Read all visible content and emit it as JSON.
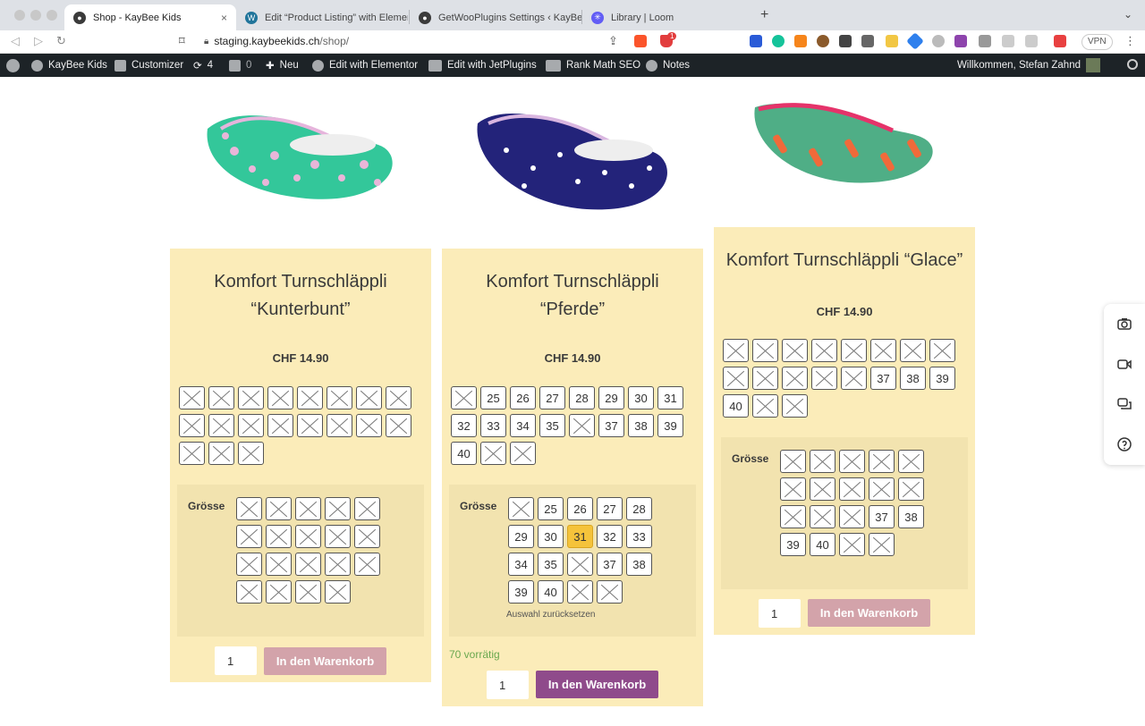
{
  "browser": {
    "tabs": [
      {
        "title": "Shop - KayBee Kids",
        "active": true
      },
      {
        "title": "Edit “Product Listing” with Elementor",
        "active": false
      },
      {
        "title": "GetWooPlugins Settings ‹ KayBee Kids",
        "active": false
      },
      {
        "title": "Library | Loom",
        "active": false
      }
    ],
    "new_tab_label": "+",
    "url_host": "staging.kaybeekids.ch",
    "url_path": "/shop/",
    "vpn_label": "VPN",
    "notification_count": "1"
  },
  "adminbar": {
    "site_name": "KayBee Kids",
    "customizer": "Customizer",
    "updates_count": "4",
    "comments_count": "0",
    "new_label": "Neu",
    "elementor": "Edit with Elementor",
    "jetplugins": "Edit with JetPlugins",
    "rankmath": "Rank Math SEO",
    "notes": "Notes",
    "greeting": "Willkommen, Stefan Zahnd"
  },
  "products": [
    {
      "name_line1": "Komfort Turnschläppli",
      "name_line2": "“Kunterbunt”",
      "price": "CHF 14.90",
      "shoe_colors": {
        "body": "#33c79a",
        "dots": "#e9b6d9",
        "trim": "#e6b4dc"
      },
      "swatches": [
        {
          "label": "",
          "out": true
        },
        {
          "label": "",
          "out": true
        },
        {
          "label": "",
          "out": true
        },
        {
          "label": "",
          "out": true
        },
        {
          "label": "",
          "out": true
        },
        {
          "label": "",
          "out": true
        },
        {
          "label": "",
          "out": true
        },
        {
          "label": "",
          "out": true
        },
        {
          "label": "",
          "out": true
        },
        {
          "label": "",
          "out": true
        },
        {
          "label": "",
          "out": true
        },
        {
          "label": "",
          "out": true
        },
        {
          "label": "",
          "out": true
        },
        {
          "label": "",
          "out": true
        },
        {
          "label": "",
          "out": true
        },
        {
          "label": "",
          "out": true
        },
        {
          "label": "",
          "out": true
        },
        {
          "label": "",
          "out": true
        },
        {
          "label": "",
          "out": true
        }
      ],
      "groesse_label": "Grösse",
      "options": [
        {
          "label": "",
          "out": true
        },
        {
          "label": "",
          "out": true
        },
        {
          "label": "",
          "out": true
        },
        {
          "label": "",
          "out": true
        },
        {
          "label": "",
          "out": true
        },
        {
          "label": "",
          "out": true
        },
        {
          "label": "",
          "out": true
        },
        {
          "label": "",
          "out": true
        },
        {
          "label": "",
          "out": true
        },
        {
          "label": "",
          "out": true
        },
        {
          "label": "",
          "out": true
        },
        {
          "label": "",
          "out": true
        },
        {
          "label": "",
          "out": true
        },
        {
          "label": "",
          "out": true
        },
        {
          "label": "",
          "out": true
        },
        {
          "label": "",
          "out": true
        },
        {
          "label": "",
          "out": true
        },
        {
          "label": "",
          "out": true
        },
        {
          "label": "",
          "out": true
        }
      ],
      "qty": "1",
      "cart_label": "In den Warenkorb",
      "cart_enabled": false
    },
    {
      "name_line1": "Komfort Turnschläppli",
      "name_line2": "“Pferde”",
      "price": "CHF 14.90",
      "shoe_colors": {
        "body": "#23237a",
        "dots": "#ffffff",
        "trim": "#d9b6e0"
      },
      "swatches": [
        {
          "label": "",
          "out": true
        },
        {
          "label": "25",
          "out": false
        },
        {
          "label": "26",
          "out": false
        },
        {
          "label": "27",
          "out": false
        },
        {
          "label": "28",
          "out": false
        },
        {
          "label": "29",
          "out": false
        },
        {
          "label": "30",
          "out": false
        },
        {
          "label": "31",
          "out": false
        },
        {
          "label": "32",
          "out": false
        },
        {
          "label": "33",
          "out": false
        },
        {
          "label": "34",
          "out": false
        },
        {
          "label": "35",
          "out": false
        },
        {
          "label": "",
          "out": true
        },
        {
          "label": "37",
          "out": false
        },
        {
          "label": "38",
          "out": false
        },
        {
          "label": "39",
          "out": false
        },
        {
          "label": "40",
          "out": false
        },
        {
          "label": "",
          "out": true
        },
        {
          "label": "",
          "out": true
        }
      ],
      "groesse_label": "Grösse",
      "options": [
        {
          "label": "",
          "out": true
        },
        {
          "label": "25",
          "out": false
        },
        {
          "label": "26",
          "out": false
        },
        {
          "label": "27",
          "out": false
        },
        {
          "label": "28",
          "out": false
        },
        {
          "label": "29",
          "out": false
        },
        {
          "label": "30",
          "out": false
        },
        {
          "label": "31",
          "out": false,
          "selected": true
        },
        {
          "label": "32",
          "out": false
        },
        {
          "label": "33",
          "out": false
        },
        {
          "label": "34",
          "out": false
        },
        {
          "label": "35",
          "out": false
        },
        {
          "label": "",
          "out": true
        },
        {
          "label": "37",
          "out": false
        },
        {
          "label": "38",
          "out": false
        },
        {
          "label": "39",
          "out": false
        },
        {
          "label": "40",
          "out": false
        },
        {
          "label": "",
          "out": true
        },
        {
          "label": "",
          "out": true
        }
      ],
      "reset_label": "Auswahl zurücksetzen",
      "stock_label": "70 vorrätig",
      "qty": "1",
      "cart_label": "In den Warenkorb",
      "cart_enabled": true
    },
    {
      "name_line1": "Komfort Turnschläppli “Glace”",
      "name_line2": "",
      "price": "CHF 14.90",
      "shoe_colors": {
        "body": "#4fae86",
        "dots": "#f06a3a",
        "trim": "#e5336a"
      },
      "swatches": [
        {
          "label": "",
          "out": true
        },
        {
          "label": "",
          "out": true
        },
        {
          "label": "",
          "out": true
        },
        {
          "label": "",
          "out": true
        },
        {
          "label": "",
          "out": true
        },
        {
          "label": "",
          "out": true
        },
        {
          "label": "",
          "out": true
        },
        {
          "label": "",
          "out": true
        },
        {
          "label": "",
          "out": true
        },
        {
          "label": "",
          "out": true
        },
        {
          "label": "",
          "out": true
        },
        {
          "label": "",
          "out": true
        },
        {
          "label": "",
          "out": true
        },
        {
          "label": "37",
          "out": false
        },
        {
          "label": "38",
          "out": false
        },
        {
          "label": "39",
          "out": false
        },
        {
          "label": "40",
          "out": false
        },
        {
          "label": "",
          "out": true
        },
        {
          "label": "",
          "out": true
        }
      ],
      "groesse_label": "Grösse",
      "options": [
        {
          "label": "",
          "out": true
        },
        {
          "label": "",
          "out": true
        },
        {
          "label": "",
          "out": true
        },
        {
          "label": "",
          "out": true
        },
        {
          "label": "",
          "out": true
        },
        {
          "label": "",
          "out": true
        },
        {
          "label": "",
          "out": true
        },
        {
          "label": "",
          "out": true
        },
        {
          "label": "",
          "out": true
        },
        {
          "label": "",
          "out": true
        },
        {
          "label": "",
          "out": true
        },
        {
          "label": "",
          "out": true
        },
        {
          "label": "",
          "out": true
        },
        {
          "label": "37",
          "out": false
        },
        {
          "label": "38",
          "out": false
        },
        {
          "label": "39",
          "out": false
        },
        {
          "label": "40",
          "out": false
        },
        {
          "label": "",
          "out": true
        },
        {
          "label": "",
          "out": true
        }
      ],
      "qty": "1",
      "cart_label": "In den Warenkorb",
      "cart_enabled": false
    }
  ],
  "side_panel": {
    "icons": [
      "camera-icon",
      "video-icon",
      "comments-icon",
      "help-icon"
    ]
  }
}
